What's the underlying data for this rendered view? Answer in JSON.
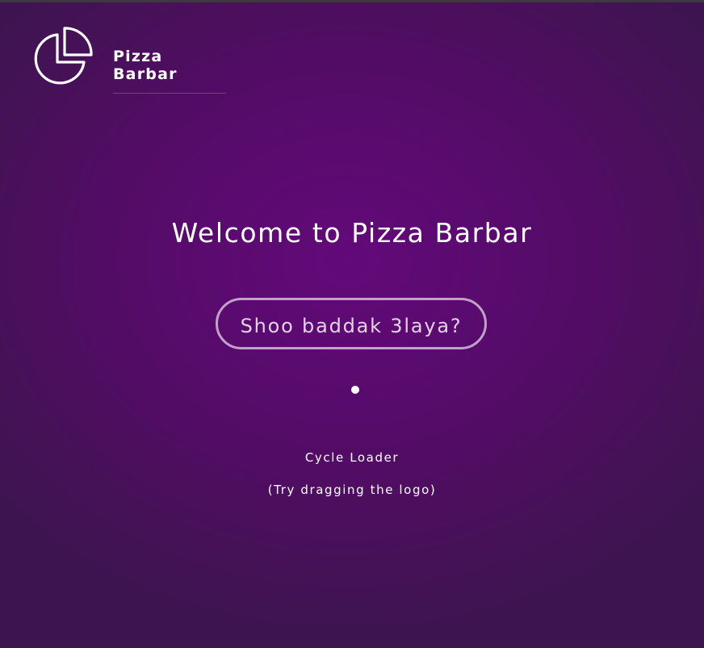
{
  "header": {
    "brand": "Pizza Barbar",
    "logo_icon": "pie-chart-icon"
  },
  "main": {
    "welcome_title": "Welcome to Pizza Barbar",
    "cta_label": "Shoo baddak 3laya?",
    "loader_label": "Cycle Loader",
    "hint": "(Try dragging the logo)"
  },
  "colors": {
    "background_center": "#63097a",
    "background_edge": "#3e1450",
    "text": "#ffffff"
  }
}
